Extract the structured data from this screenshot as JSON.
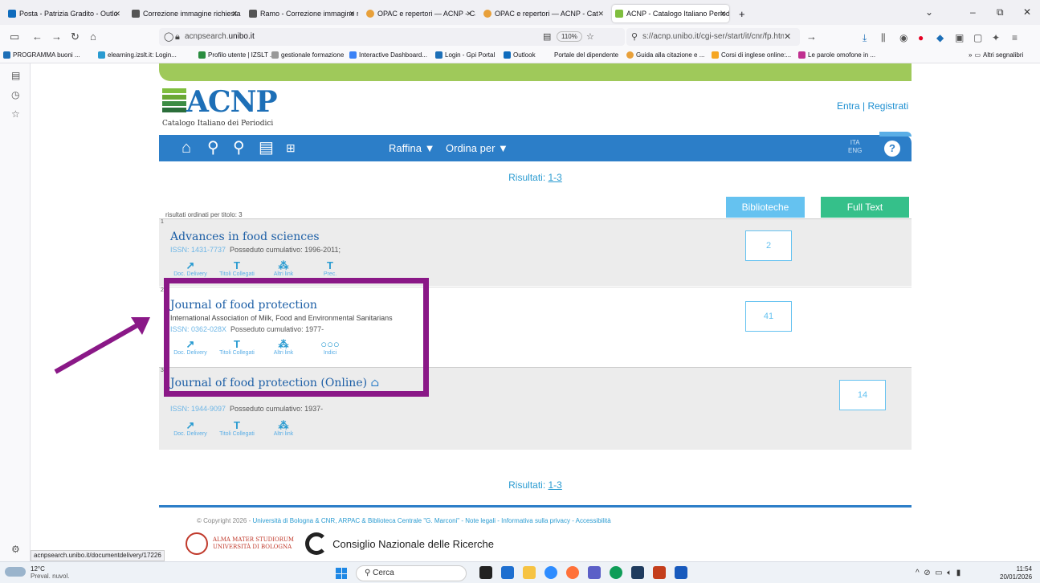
{
  "browser": {
    "tabs": [
      {
        "label": "Posta - Patrizia Gradito - Outlo",
        "color": "#0f6cbd"
      },
      {
        "label": "Correzione immagine richiesta",
        "color": "#555555"
      },
      {
        "label": "Ramo - Correzione immagine ri",
        "color": "#555555"
      },
      {
        "label": "OPAC e repertori — ACNP - Cat",
        "color": "#e8a03a"
      },
      {
        "label": "OPAC e repertori — ACNP - Cat",
        "color": "#e8a03a"
      },
      {
        "label": "ACNP - Catalogo Italiano Period",
        "color": "#7fbe3e"
      }
    ],
    "new_tab": "+",
    "url_host": "acnpsearch.",
    "url_host_bold": "unibo.it",
    "zoom": "110%",
    "search_text": "s://acnp.unibo.it/cgi-ser/start/it/cnr/fp.html",
    "bookmarks": [
      "PROGRAMMA buoni ...",
      "elearning.izslt.it: Login...",
      "Profilo utente | IZSLT ...",
      "gestionale formazione",
      "Interactive Dashboard...",
      "Login - Gpi Portal",
      "Outlook",
      "Portale del dipendente",
      "Guida alla citazione e ...",
      "Corsi di inglese online:...",
      "Le parole omofone in ..."
    ],
    "other_bookmarks": "Altri segnalibri",
    "status_url": "acnpsearch.unibo.it/documentdelivery/17226"
  },
  "site": {
    "logo_text": "ACNP",
    "logo_sub": "Catalogo Italiano dei Periodici",
    "login": "Entra | Registrati",
    "menu_raffina": "Raffina ▼",
    "menu_ordina": "Ordina per ▼",
    "lang_ita": "ITA",
    "lang_eng": "ENG",
    "help": "?",
    "results_label": "Risultati:",
    "results_range": "1-3",
    "btn_biblioteche": "Biblioteche",
    "btn_fulltext": "Full Text",
    "order_note": "risultati ordinati per titolo: 3",
    "colors": {
      "green": "#9fc95a",
      "blue": "#2c7ec8",
      "highlight": "#8a1887"
    }
  },
  "records": [
    {
      "num": "1",
      "title": "Advances in food sciences",
      "publisher": "",
      "issn": "ISSN: 1431-7737",
      "holdings": "Posseduto cumulativo: 1996-2011;",
      "tools": [
        "Doc. Delivery",
        "Titoli Collegati",
        "Altri link",
        "Prec."
      ],
      "count": "2"
    },
    {
      "num": "2",
      "title": "Journal of food protection",
      "publisher": "International Association of Milk, Food and Environmental Sanitarians",
      "issn": "ISSN: 0362-028X",
      "holdings": "Posseduto cumulativo: 1977-",
      "tools": [
        "Doc. Delivery",
        "Titoli Collegati",
        "Altri link",
        "Indici"
      ],
      "count": "41"
    },
    {
      "num": "3",
      "title": "Journal of food protection (Online)",
      "publisher": "",
      "issn": "ISSN: 1944-9097",
      "holdings": "Posseduto cumulativo: 1937-",
      "tools": [
        "Doc. Delivery",
        "Titoli Collegati",
        "Altri link"
      ],
      "count": "14"
    }
  ],
  "footer": {
    "copyright": "© Copyright 2026 -",
    "links": "Università di Bologna & CNR, ARPAC & Biblioteca Centrale \"G. Marconi\" - Note legali - Informativa sulla privacy - Accessibilità",
    "unibo_line1": "ALMA MATER STUDIORUM",
    "unibo_line2": "UNIVERSITÀ DI BOLOGNA",
    "cnr": "Consiglio Nazionale delle Ricerche"
  },
  "taskbar": {
    "temp": "12°C",
    "weather": "Preval. nuvol.",
    "search": "Cerca",
    "time": "11:54",
    "date": "20/01/2026"
  }
}
